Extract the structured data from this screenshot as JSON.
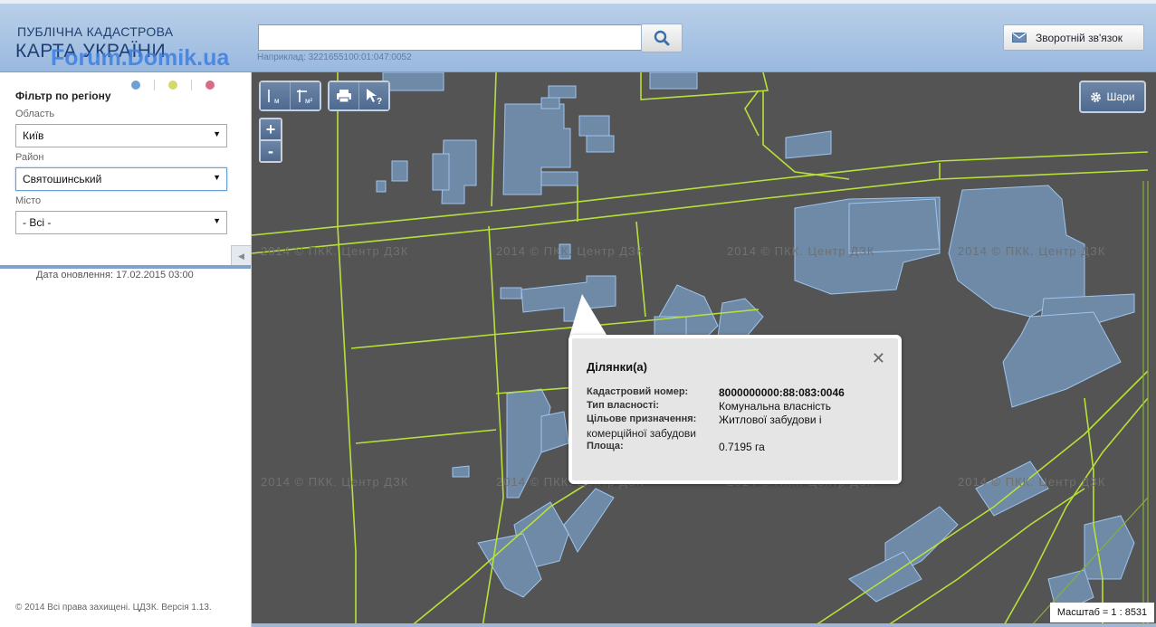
{
  "header": {
    "logo_line1": "ПУБЛІЧНА КАДАСТРОВА",
    "logo_line2": "КАРТА УКРАЇНИ",
    "watermark": "Forum.Domik.ua",
    "search": {
      "value": "",
      "example": "Наприклад: 3221655100:01:047:0052",
      "icon": "search-icon"
    },
    "feedback_label": "Зворотній зв'язок"
  },
  "sidebar": {
    "dot_colors": [
      "#6ea0d6",
      "#d4d86a",
      "#d96b86"
    ],
    "filter_title": "Фільтр по регіону",
    "fields": [
      {
        "label": "Область",
        "value": "Київ"
      },
      {
        "label": "Район",
        "value": "Святошинський"
      },
      {
        "label": "Місто",
        "value": "- Всі -"
      }
    ],
    "updated": "Дата оновлення: 17.02.2015 03:00",
    "copyright": "© 2014 Всі права захищені. ЦДЗК. Версія 1.13."
  },
  "map": {
    "tools": [
      {
        "name": "measure-length-tool",
        "label": "м"
      },
      {
        "name": "measure-area-tool",
        "label": "м²"
      },
      {
        "name": "print-tool",
        "label": ""
      },
      {
        "name": "identify-tool",
        "label": "?"
      }
    ],
    "zoom_in": "+",
    "zoom_out": "-",
    "layers_label": "Шари",
    "watermark_text": "2014 © ПКК. Центр ДЗК",
    "scale_text": "Масштаб = 1 : 8531",
    "colors": {
      "background": "#545454",
      "parcel_border": "#b8e03a",
      "building_fill": "#6e8aa6",
      "building_stroke": "#9ec4ee"
    }
  },
  "popup": {
    "title": "Ділянки(а)",
    "rows": [
      {
        "label": "Кадастровий номер:",
        "value": "8000000000:88:083:0046"
      },
      {
        "label": "Тип власності:",
        "value": "Комунальна власність"
      },
      {
        "label": "Цільове призначення:",
        "value": "Житлової забудови і"
      },
      {
        "label": "комерційної забудови",
        "value": ""
      },
      {
        "label": "Площа:",
        "value": "0.7195 га"
      }
    ]
  }
}
